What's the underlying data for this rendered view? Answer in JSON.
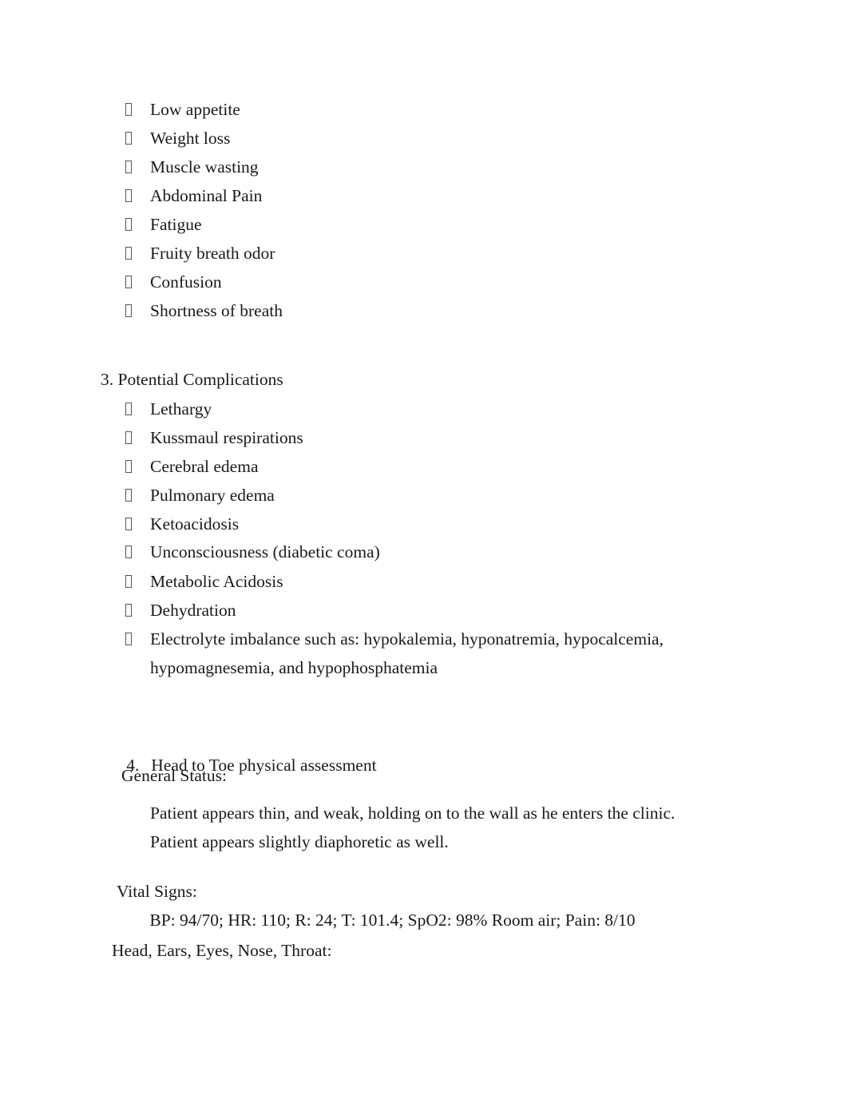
{
  "document": {
    "page_background": "#ffffff",
    "text_color": "#1a1a1a",
    "bullet_glyph": "tofu-box-icon"
  },
  "symptoms_list": {
    "items": [
      "Low appetite",
      "Weight loss",
      "Muscle wasting",
      "Abdominal Pain",
      "Fatigue",
      "Fruity breath odor",
      "Confusion",
      "Shortness of breath"
    ]
  },
  "section_3": {
    "heading": "3. Potential Complications",
    "items": [
      "Lethargy",
      "Kussmaul respirations",
      "Cerebral edema",
      "Pulmonary edema",
      "Ketoacidosis",
      "Unconsciousness (diabetic coma)",
      "Metabolic Acidosis",
      "Dehydration",
      "Electrolyte imbalance such as: hypokalemia, hyponatremia, hypocalcemia, hypomagnesemia, and hypophosphatemia"
    ]
  },
  "section_4": {
    "number": "4.",
    "heading": "Head to Toe physical assessment",
    "general_status_label": "General Status:",
    "general_status_text": "Patient appears thin, and weak, holding on to the wall as he enters the clinic. Patient appears slightly diaphoretic as well.",
    "vital_signs_label": "Vital Signs:",
    "vital_signs_values": " BP: 94/70; HR: 110; R: 24; T: 101.4; SpO2: 98% Room air; Pain: 8/10",
    "heent_label": "Head, Ears, Eyes, Nose, Throat:"
  }
}
